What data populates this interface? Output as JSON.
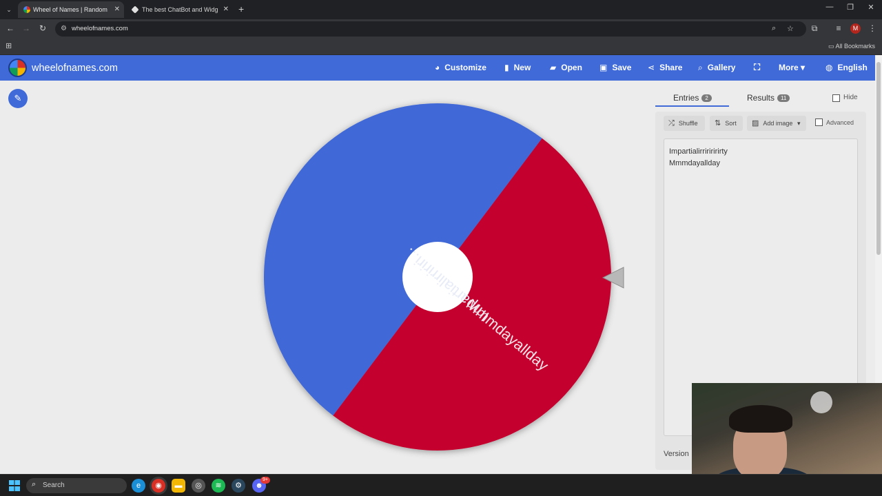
{
  "browser": {
    "tabs": [
      {
        "title": "Wheel of Names | Random nam",
        "active": true
      },
      {
        "title": "The best ChatBot and Widgets",
        "active": false
      }
    ],
    "new_tab": "+",
    "url": "wheelofnames.com",
    "profile_initial": "M",
    "bookmarks_label": "All Bookmarks"
  },
  "site": {
    "logo_text": "wheelofnames.com",
    "menu": [
      {
        "label": "Customize",
        "icon": "palette-icon",
        "glyph": "◕"
      },
      {
        "label": "New",
        "icon": "file-icon",
        "glyph": "▮"
      },
      {
        "label": "Open",
        "icon": "folder-icon",
        "glyph": "▰"
      },
      {
        "label": "Save",
        "icon": "save-icon",
        "glyph": "▣"
      },
      {
        "label": "Share",
        "icon": "share-icon",
        "glyph": "⋖"
      },
      {
        "label": "Gallery",
        "icon": "search-icon",
        "glyph": "⌕"
      },
      {
        "label": "",
        "icon": "fullscreen-icon",
        "glyph": "⛶"
      },
      {
        "label": "More",
        "icon": "chevron-down-icon",
        "glyph": "▾"
      },
      {
        "label": "English",
        "icon": "globe-icon",
        "glyph": "◍"
      }
    ]
  },
  "wheel": {
    "segments": [
      {
        "label": "Impartialirririri...",
        "color": "#3f68d6"
      },
      {
        "label": "Mmmdayallday",
        "color": "#c3002f"
      }
    ],
    "center_color": "#ffffff",
    "pointer_color": "#b8b8b8"
  },
  "panel": {
    "tabs": [
      {
        "label": "Entries",
        "count": "2"
      },
      {
        "label": "Results",
        "count": "11"
      }
    ],
    "hide_label": "Hide",
    "toolbar": {
      "shuffle": "Shuffle",
      "sort": "Sort",
      "add_image": "Add image",
      "advanced": "Advanced"
    },
    "entries": [
      "Impartialirririririrty",
      "Mmmdayallday"
    ],
    "version_label": "Version"
  },
  "taskbar": {
    "search_placeholder": "Search",
    "apps": [
      {
        "name": "edge-icon",
        "color": "#1a8fd6"
      },
      {
        "name": "chrome-icon",
        "color": "#d93025"
      },
      {
        "name": "file-explorer-icon",
        "color": "#f2b705"
      },
      {
        "name": "app-icon",
        "color": "#555555"
      },
      {
        "name": "spotify-icon",
        "color": "#1db954"
      },
      {
        "name": "steam-icon",
        "color": "#2a475e"
      },
      {
        "name": "discord-icon",
        "color": "#5865f2"
      }
    ],
    "discord_badge": "9+"
  }
}
